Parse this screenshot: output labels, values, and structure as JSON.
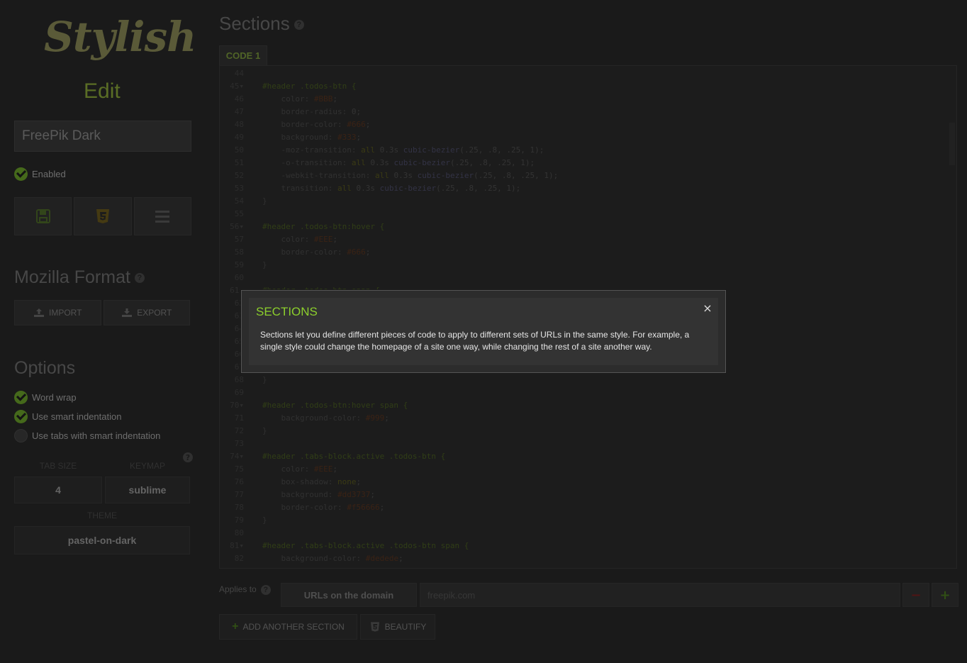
{
  "sidebar": {
    "logo": "Stylish",
    "mode": "Edit",
    "style_name": "FreePik Dark",
    "enabled_label": "Enabled",
    "icons": [
      "save-icon",
      "css3-icon",
      "menu-icon"
    ],
    "mozilla_title": "Mozilla Format",
    "import_label": "IMPORT",
    "export_label": "EXPORT",
    "options_title": "Options",
    "options": [
      {
        "label": "Word wrap",
        "checked": true
      },
      {
        "label": "Use smart indentation",
        "checked": true
      },
      {
        "label": "Use tabs with smart indentation",
        "checked": false
      }
    ],
    "tab_size_label": "TAB SIZE",
    "tab_size": "4",
    "keymap_label": "KEYMAP",
    "keymap": "sublime",
    "theme_label": "THEME",
    "theme": "pastel-on-dark"
  },
  "main": {
    "title": "Sections",
    "code_tab": "CODE 1",
    "code_lines": [
      {
        "n": "44",
        "t": ""
      },
      {
        "n": "45▾",
        "t": "#header .todos-btn {"
      },
      {
        "n": "46",
        "t": "    color: #BBB;"
      },
      {
        "n": "47",
        "t": "    border-radius: 0;"
      },
      {
        "n": "48",
        "t": "    border-color: #666;"
      },
      {
        "n": "49",
        "t": "    background: #333;"
      },
      {
        "n": "50",
        "t": "    -moz-transition: all 0.3s cubic-bezier(.25, .8, .25, 1);"
      },
      {
        "n": "51",
        "t": "    -o-transition: all 0.3s cubic-bezier(.25, .8, .25, 1);"
      },
      {
        "n": "52",
        "t": "    -webkit-transition: all 0.3s cubic-bezier(.25, .8, .25, 1);"
      },
      {
        "n": "53",
        "t": "    transition: all 0.3s cubic-bezier(.25, .8, .25, 1);"
      },
      {
        "n": "54",
        "t": "}"
      },
      {
        "n": "55",
        "t": ""
      },
      {
        "n": "56▾",
        "t": "#header .todos-btn:hover {"
      },
      {
        "n": "57",
        "t": "    color: #EEE;"
      },
      {
        "n": "58",
        "t": "    border-color: #666;"
      },
      {
        "n": "59",
        "t": "}"
      },
      {
        "n": "60",
        "t": ""
      },
      {
        "n": "61▾",
        "t": "#header .todos-btn span {"
      },
      {
        "n": "62",
        "t": ""
      },
      {
        "n": "63",
        "t": ""
      },
      {
        "n": "64",
        "t": ""
      },
      {
        "n": "65",
        "t": ""
      },
      {
        "n": "66",
        "t": ""
      },
      {
        "n": "67",
        "t": ""
      },
      {
        "n": "68",
        "t": "}"
      },
      {
        "n": "69",
        "t": ""
      },
      {
        "n": "70▾",
        "t": "#header .todos-btn:hover span {"
      },
      {
        "n": "71",
        "t": "    background-color: #999;"
      },
      {
        "n": "72",
        "t": "}"
      },
      {
        "n": "73",
        "t": ""
      },
      {
        "n": "74▾",
        "t": "#header .tabs-block.active .todos-btn {"
      },
      {
        "n": "75",
        "t": "    color: #EEE;"
      },
      {
        "n": "76",
        "t": "    box-shadow: none;"
      },
      {
        "n": "77",
        "t": "    background: #dd3737;"
      },
      {
        "n": "78",
        "t": "    border-color: #f56666;"
      },
      {
        "n": "79",
        "t": "}"
      },
      {
        "n": "80",
        "t": ""
      },
      {
        "n": "81▾",
        "t": "#header .tabs-block.active .todos-btn span {"
      },
      {
        "n": "82",
        "t": "    background-color: #dedede;"
      }
    ],
    "applies_label": "Applies to",
    "url_type": "URLs on the domain",
    "url_value": "freepik.com",
    "remove_label": "−",
    "add_label": "+",
    "add_section_label": "ADD ANOTHER SECTION",
    "beautify_label": "BEAUTIFY"
  },
  "modal": {
    "title": "SECTIONS",
    "close": "×",
    "body": "Sections let you define different pieces of code to apply to different sets of URLs in the same style. For example, a single style could change the homepage of a site one way, while changing the rest of a site another way."
  }
}
